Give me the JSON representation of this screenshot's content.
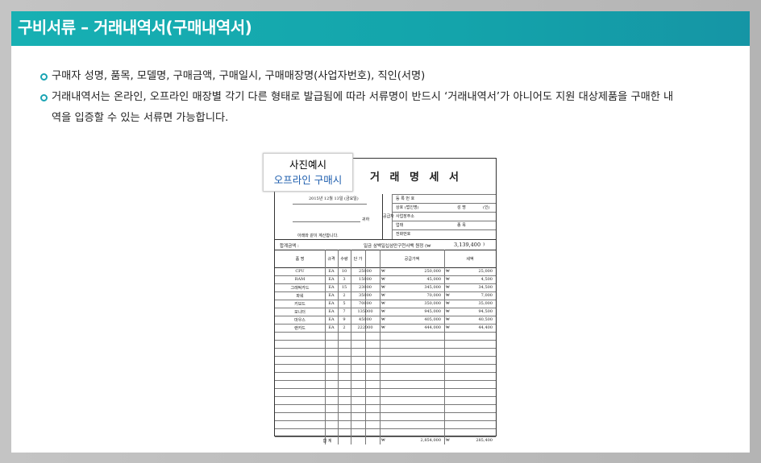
{
  "header": {
    "title": "구비서류 – 거래내역서(구매내역서)"
  },
  "bullets": [
    {
      "text": "구매자 성명, 품목, 모델명, 구매금액, 구매일시, 구매매장명(사업자번호), 직인(서명)"
    },
    {
      "text_line1": "거래내역서는 온라인, 오프라인 매장별 각기 다른 형태로 발급됨에 따라 서류명이 반드시 ‘거래내역서’가 아니어도 지원 대상제품을 구매한 내",
      "text_line2": "역을 입증할 수 있는 서류면 가능합니다."
    }
  ],
  "sample": {
    "label_line1": "사진예시",
    "label_line2": "오프라인 구매시",
    "doc_title": "거 래 명 세 서",
    "date": "2015년 12월 13일 (금요일)",
    "recipient_suffix": "귀하",
    "note": "아래와 같이 계산합니다.",
    "supplier_label": "공급자",
    "supplier_fields": [
      "등 록 번 호",
      "상호 (법인명)",
      "사업장주소",
      "업태",
      "전화번호"
    ],
    "supplier_extra": [
      "성 명",
      "(인)",
      "종 목"
    ],
    "total_label": "합계금액 :",
    "total_text": "일금 삼백일십삼만구천사백 원정 (₩",
    "total_value": "3,139,400",
    "total_close": ")",
    "columns": [
      "품 명",
      "규격",
      "수량",
      "단 가",
      "공급가액",
      "세액"
    ],
    "rows": [
      {
        "name": "CPU",
        "unit": "EA",
        "qty": "10",
        "price": "25000",
        "supply": "250,000",
        "tax": "25,000"
      },
      {
        "name": "RAM",
        "unit": "EA",
        "qty": "3",
        "price": "15000",
        "supply": "45,000",
        "tax": "4,500"
      },
      {
        "name": "그래픽카드",
        "unit": "EA",
        "qty": "15",
        "price": "23000",
        "supply": "345,000",
        "tax": "34,500"
      },
      {
        "name": "파워",
        "unit": "EA",
        "qty": "2",
        "price": "35000",
        "supply": "70,000",
        "tax": "7,000"
      },
      {
        "name": "키보드",
        "unit": "EA",
        "qty": "5",
        "price": "70000",
        "supply": "350,000",
        "tax": "35,000"
      },
      {
        "name": "모니터",
        "unit": "EA",
        "qty": "7",
        "price": "135000",
        "supply": "945,000",
        "tax": "94,500"
      },
      {
        "name": "마우스",
        "unit": "EA",
        "qty": "9",
        "price": "45000",
        "supply": "405,000",
        "tax": "40,500"
      },
      {
        "name": "랜카드",
        "unit": "EA",
        "qty": "2",
        "price": "222000",
        "supply": "444,000",
        "tax": "44,400"
      }
    ],
    "currency": "₩",
    "sum_label": "합 계",
    "sum_supply": "2,854,000",
    "sum_tax": "285,400"
  }
}
